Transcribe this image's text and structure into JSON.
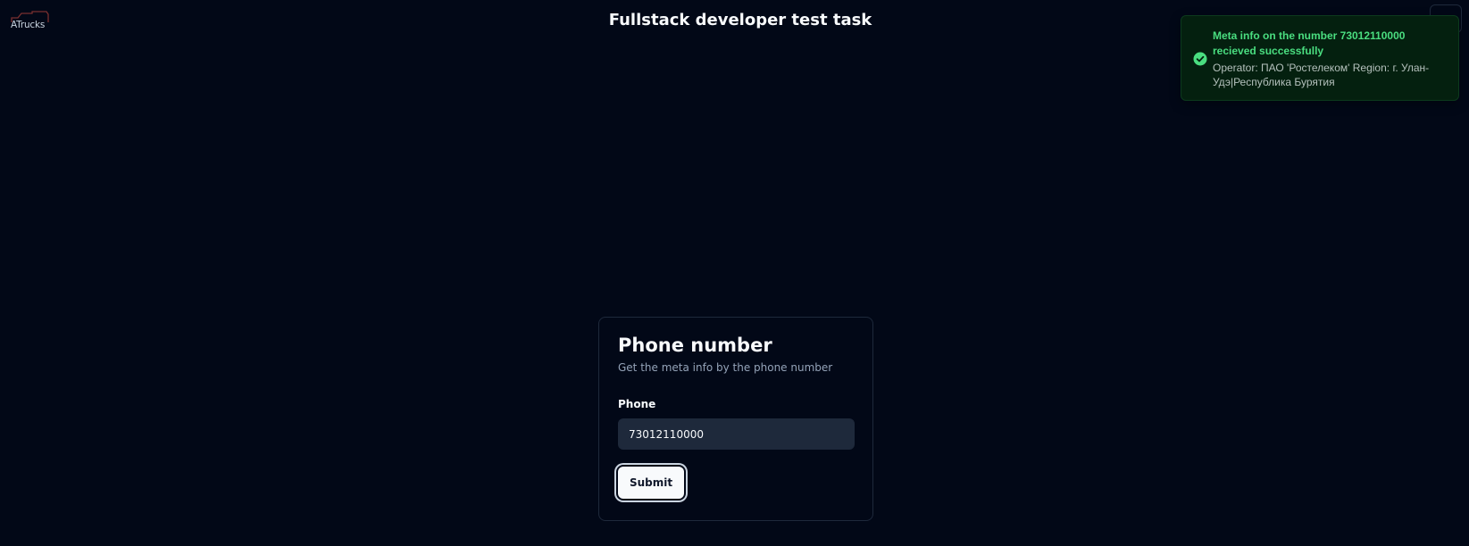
{
  "logo": {
    "text": "ATrucks"
  },
  "header": {
    "title": "Fullstack developer test task"
  },
  "toast": {
    "status": "success",
    "icon": "check-circle-icon",
    "title": "Meta info on the number 73012110000 recieved successfully",
    "description": "Operator: ПАО 'Ростелеком' Region: г. Улан-Удэ|Республика Бурятия"
  },
  "card": {
    "title": "Phone number",
    "description": "Get the meta info by the phone number",
    "phone_label": "Phone",
    "phone_value": "73012110000",
    "submit_label": "Submit"
  },
  "colors": {
    "background": "#020817",
    "toast_background": "#04200f",
    "toast_accent": "#4ade80",
    "input_background": "#1e293b"
  }
}
